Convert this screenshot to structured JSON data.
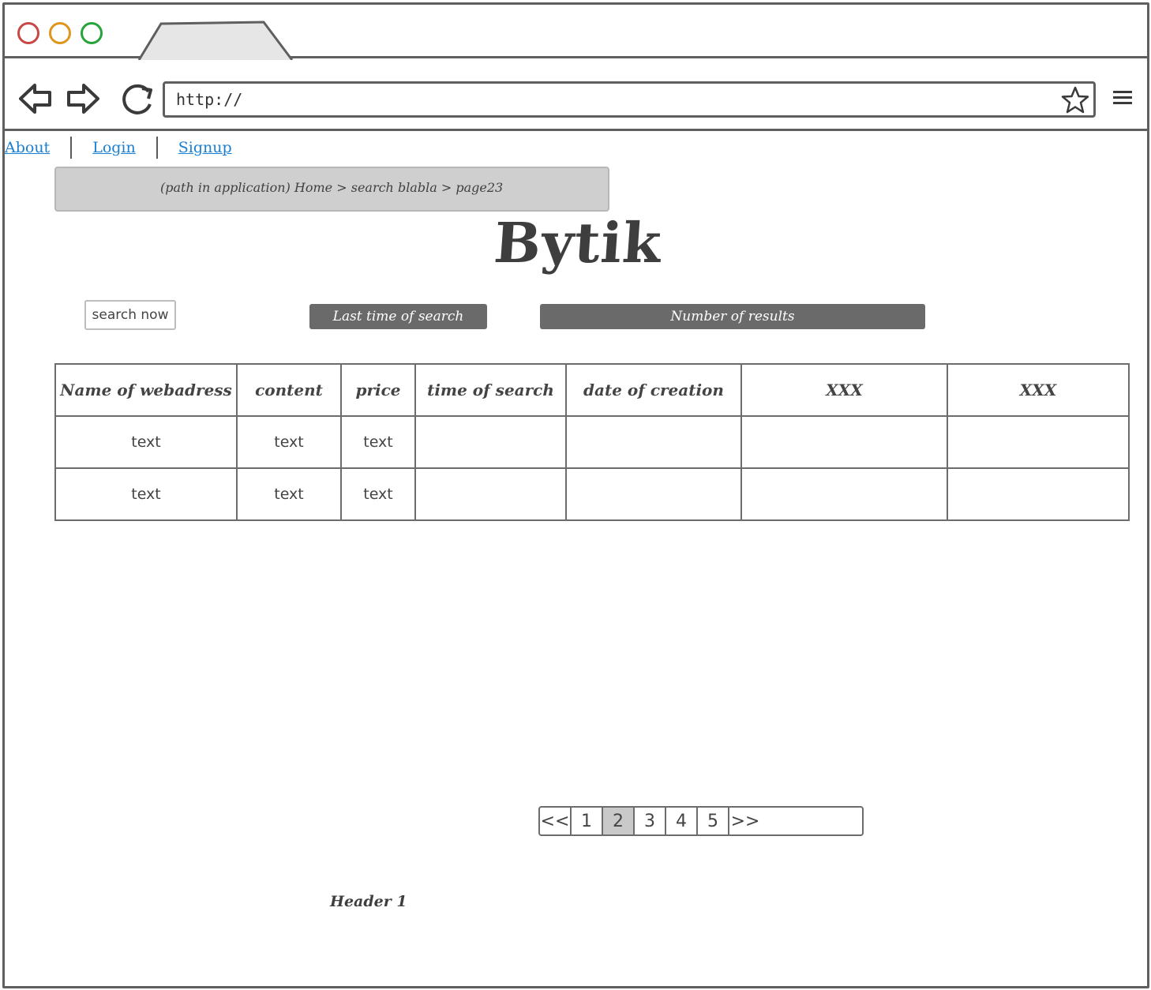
{
  "browser": {
    "url": "http://"
  },
  "top_links": [
    {
      "label": "About"
    },
    {
      "label": "Login"
    },
    {
      "label": "Signup"
    }
  ],
  "breadcrumb": "(path in application) Home > search blabla > page23",
  "title": "Bytik",
  "search_button": "search now",
  "last_time_label": "Last time of search",
  "number_of_results_label": "Number of results",
  "table": {
    "headers": [
      "Name of webadress",
      "content",
      "price",
      "time of search",
      "date of creation",
      "XXX",
      "XXX"
    ],
    "rows": [
      [
        "text",
        "text",
        "text",
        "",
        "",
        "",
        ""
      ],
      [
        "text",
        "text",
        "text",
        "",
        "",
        "",
        ""
      ]
    ]
  },
  "pagination": {
    "items": [
      "<<",
      "1",
      "2",
      "3",
      "4",
      "5",
      ">>"
    ],
    "active": "2"
  },
  "footer": "Header 1"
}
